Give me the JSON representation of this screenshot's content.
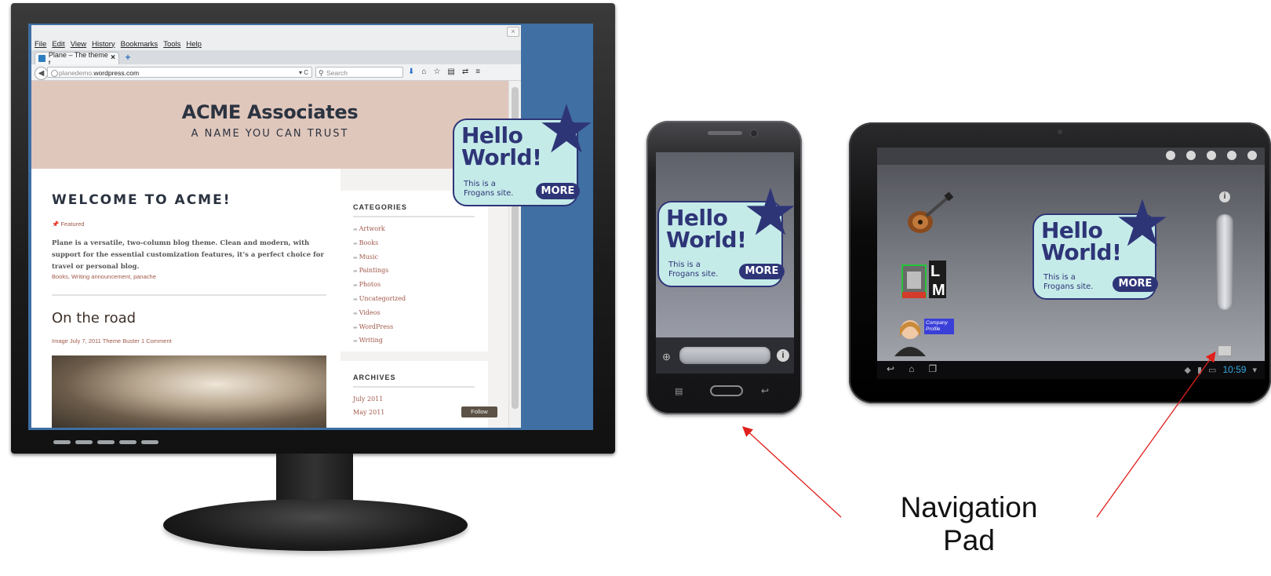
{
  "browser": {
    "close_glyph": "×",
    "menu": [
      "File",
      "Edit",
      "View",
      "History",
      "Bookmarks",
      "Tools",
      "Help"
    ],
    "tab_title": "Plane – The theme t…",
    "tab_close": "×",
    "new_tab": "+",
    "url_prefix": "planedemo.",
    "url_domain": "wordpress.com",
    "url_tail": "▾ C",
    "search_placeholder": "Search",
    "nav_icons": [
      "download-icon",
      "home-icon",
      "star-icon",
      "bookmark-list-icon",
      "share-icon",
      "menu-icon"
    ]
  },
  "site": {
    "title": "ACME Associates",
    "tagline": "A NAME YOU CAN TRUST",
    "post_title": "WELCOME TO ACME!",
    "featured_label": "Featured",
    "post_body": "Plane is a versatile, two-column blog theme. Clean and modern, with support for the essential customization features, it’s a perfect choice for travel or personal blog.",
    "post_meta": "Books, Writing    announcement, panache",
    "post2_title": "On the road",
    "post2_meta": "Image    July 7, 2011    Theme Buster    1 Comment",
    "follow_label": "Follow"
  },
  "sidebar": {
    "categories_title": "CATEGORIES",
    "categories": [
      "Artwork",
      "Books",
      "Music",
      "Paintings",
      "Photos",
      "Uncategorized",
      "Videos",
      "WordPress",
      "Writing"
    ],
    "archives_title": "ARCHIVES",
    "archives": [
      "July 2011",
      "May 2011"
    ]
  },
  "frogans": {
    "hello": "Hello",
    "world": "World!",
    "sub_line1": "This is a",
    "sub_line2": "Frogans site.",
    "more": "MORE",
    "colors": {
      "fill": "#c5ebe9",
      "ink": "#2e3577"
    }
  },
  "tablet": {
    "time": "10:59",
    "profile_label": "Company Profile"
  },
  "annotation": {
    "line1": "Navigation",
    "line2": "Pad",
    "arrow_color": "#e0201c"
  }
}
